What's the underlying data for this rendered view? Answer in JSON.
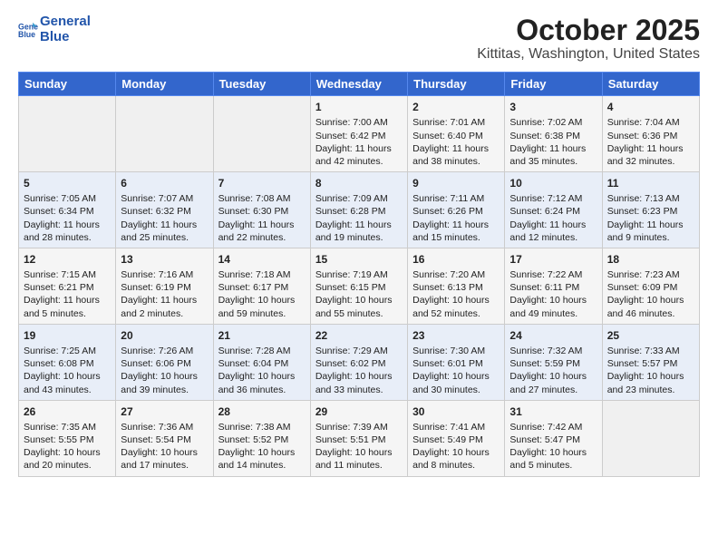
{
  "header": {
    "logo_line1": "General",
    "logo_line2": "Blue",
    "month": "October 2025",
    "location": "Kittitas, Washington, United States"
  },
  "weekdays": [
    "Sunday",
    "Monday",
    "Tuesday",
    "Wednesday",
    "Thursday",
    "Friday",
    "Saturday"
  ],
  "weeks": [
    [
      {
        "day": "",
        "content": ""
      },
      {
        "day": "",
        "content": ""
      },
      {
        "day": "",
        "content": ""
      },
      {
        "day": "1",
        "content": "Sunrise: 7:00 AM\nSunset: 6:42 PM\nDaylight: 11 hours\nand 42 minutes."
      },
      {
        "day": "2",
        "content": "Sunrise: 7:01 AM\nSunset: 6:40 PM\nDaylight: 11 hours\nand 38 minutes."
      },
      {
        "day": "3",
        "content": "Sunrise: 7:02 AM\nSunset: 6:38 PM\nDaylight: 11 hours\nand 35 minutes."
      },
      {
        "day": "4",
        "content": "Sunrise: 7:04 AM\nSunset: 6:36 PM\nDaylight: 11 hours\nand 32 minutes."
      }
    ],
    [
      {
        "day": "5",
        "content": "Sunrise: 7:05 AM\nSunset: 6:34 PM\nDaylight: 11 hours\nand 28 minutes."
      },
      {
        "day": "6",
        "content": "Sunrise: 7:07 AM\nSunset: 6:32 PM\nDaylight: 11 hours\nand 25 minutes."
      },
      {
        "day": "7",
        "content": "Sunrise: 7:08 AM\nSunset: 6:30 PM\nDaylight: 11 hours\nand 22 minutes."
      },
      {
        "day": "8",
        "content": "Sunrise: 7:09 AM\nSunset: 6:28 PM\nDaylight: 11 hours\nand 19 minutes."
      },
      {
        "day": "9",
        "content": "Sunrise: 7:11 AM\nSunset: 6:26 PM\nDaylight: 11 hours\nand 15 minutes."
      },
      {
        "day": "10",
        "content": "Sunrise: 7:12 AM\nSunset: 6:24 PM\nDaylight: 11 hours\nand 12 minutes."
      },
      {
        "day": "11",
        "content": "Sunrise: 7:13 AM\nSunset: 6:23 PM\nDaylight: 11 hours\nand 9 minutes."
      }
    ],
    [
      {
        "day": "12",
        "content": "Sunrise: 7:15 AM\nSunset: 6:21 PM\nDaylight: 11 hours\nand 5 minutes."
      },
      {
        "day": "13",
        "content": "Sunrise: 7:16 AM\nSunset: 6:19 PM\nDaylight: 11 hours\nand 2 minutes."
      },
      {
        "day": "14",
        "content": "Sunrise: 7:18 AM\nSunset: 6:17 PM\nDaylight: 10 hours\nand 59 minutes."
      },
      {
        "day": "15",
        "content": "Sunrise: 7:19 AM\nSunset: 6:15 PM\nDaylight: 10 hours\nand 55 minutes."
      },
      {
        "day": "16",
        "content": "Sunrise: 7:20 AM\nSunset: 6:13 PM\nDaylight: 10 hours\nand 52 minutes."
      },
      {
        "day": "17",
        "content": "Sunrise: 7:22 AM\nSunset: 6:11 PM\nDaylight: 10 hours\nand 49 minutes."
      },
      {
        "day": "18",
        "content": "Sunrise: 7:23 AM\nSunset: 6:09 PM\nDaylight: 10 hours\nand 46 minutes."
      }
    ],
    [
      {
        "day": "19",
        "content": "Sunrise: 7:25 AM\nSunset: 6:08 PM\nDaylight: 10 hours\nand 43 minutes."
      },
      {
        "day": "20",
        "content": "Sunrise: 7:26 AM\nSunset: 6:06 PM\nDaylight: 10 hours\nand 39 minutes."
      },
      {
        "day": "21",
        "content": "Sunrise: 7:28 AM\nSunset: 6:04 PM\nDaylight: 10 hours\nand 36 minutes."
      },
      {
        "day": "22",
        "content": "Sunrise: 7:29 AM\nSunset: 6:02 PM\nDaylight: 10 hours\nand 33 minutes."
      },
      {
        "day": "23",
        "content": "Sunrise: 7:30 AM\nSunset: 6:01 PM\nDaylight: 10 hours\nand 30 minutes."
      },
      {
        "day": "24",
        "content": "Sunrise: 7:32 AM\nSunset: 5:59 PM\nDaylight: 10 hours\nand 27 minutes."
      },
      {
        "day": "25",
        "content": "Sunrise: 7:33 AM\nSunset: 5:57 PM\nDaylight: 10 hours\nand 23 minutes."
      }
    ],
    [
      {
        "day": "26",
        "content": "Sunrise: 7:35 AM\nSunset: 5:55 PM\nDaylight: 10 hours\nand 20 minutes."
      },
      {
        "day": "27",
        "content": "Sunrise: 7:36 AM\nSunset: 5:54 PM\nDaylight: 10 hours\nand 17 minutes."
      },
      {
        "day": "28",
        "content": "Sunrise: 7:38 AM\nSunset: 5:52 PM\nDaylight: 10 hours\nand 14 minutes."
      },
      {
        "day": "29",
        "content": "Sunrise: 7:39 AM\nSunset: 5:51 PM\nDaylight: 10 hours\nand 11 minutes."
      },
      {
        "day": "30",
        "content": "Sunrise: 7:41 AM\nSunset: 5:49 PM\nDaylight: 10 hours\nand 8 minutes."
      },
      {
        "day": "31",
        "content": "Sunrise: 7:42 AM\nSunset: 5:47 PM\nDaylight: 10 hours\nand 5 minutes."
      },
      {
        "day": "",
        "content": ""
      }
    ]
  ]
}
